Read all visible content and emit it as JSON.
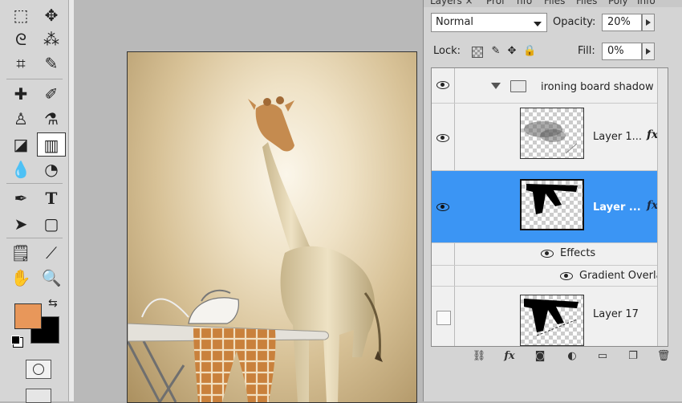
{
  "tools_panel": {
    "tools": [
      {
        "name": "marquee-tool-icon",
        "glyph": "⬚"
      },
      {
        "name": "move-tool-icon",
        "glyph": "✥"
      },
      {
        "name": "lasso-tool-icon",
        "glyph": "ᘓ"
      },
      {
        "name": "magic-wand-tool-icon",
        "glyph": "⁂"
      },
      {
        "name": "crop-tool-icon",
        "glyph": "⌗"
      },
      {
        "name": "eyedropper-tool-icon",
        "glyph": "✎"
      },
      {
        "name": "healing-brush-tool-icon",
        "glyph": "✚"
      },
      {
        "name": "brush-tool-icon",
        "glyph": "✐"
      },
      {
        "name": "clone-stamp-tool-icon",
        "glyph": "♙"
      },
      {
        "name": "history-brush-tool-icon",
        "glyph": "⚗"
      },
      {
        "name": "eraser-tool-icon",
        "glyph": "◪"
      },
      {
        "name": "gradient-tool-icon",
        "glyph": "▥"
      },
      {
        "name": "blur-tool-icon",
        "glyph": "💧"
      },
      {
        "name": "dodge-tool-icon",
        "glyph": "◔"
      },
      {
        "name": "pen-tool-icon",
        "glyph": "✒"
      },
      {
        "name": "type-tool-icon",
        "glyph": "T"
      },
      {
        "name": "path-selection-tool-icon",
        "glyph": "➤"
      },
      {
        "name": "shape-tool-icon",
        "glyph": "▢"
      },
      {
        "name": "notes-tool-icon",
        "glyph": "🗒"
      },
      {
        "name": "color-sampler-tool-icon",
        "glyph": "⟋"
      },
      {
        "name": "hand-tool-icon",
        "glyph": "✋"
      },
      {
        "name": "zoom-tool-icon",
        "glyph": "🔍"
      }
    ],
    "selected_tool": "gradient-tool-icon",
    "foreground_color": "#e8975a",
    "background_color": "#000000"
  },
  "layers_panel": {
    "tabs": [
      "Layers ×",
      "Prof",
      "nfo",
      "Files",
      "Files",
      "Poly",
      "Info"
    ],
    "blend_mode": "Normal",
    "opacity_label": "Opacity:",
    "opacity_value": "20%",
    "lock_label": "Lock:",
    "fill_label": "Fill:",
    "fill_value": "0%",
    "group_name": "ironing board shadow",
    "layer_top_name": "Layer 1...",
    "layer_selected_name": "Layer ...",
    "effects_label": "Effects",
    "gradient_overlay_label": "Gradient Overlay",
    "layer_bottom_name": "Layer 17",
    "fx_label": "fx",
    "selected_color": "#3b95f4"
  },
  "bottom_bar_icons": [
    "link-layers-icon",
    "layer-style-fx-icon",
    "add-mask-icon",
    "adjustment-layer-icon",
    "new-group-folder-icon",
    "new-layer-icon",
    "delete-layer-trash-icon"
  ]
}
